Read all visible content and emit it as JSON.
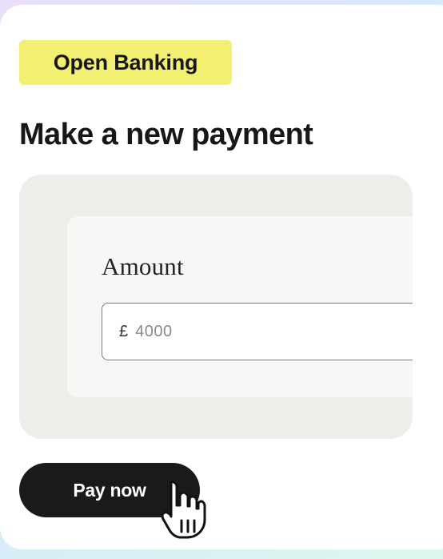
{
  "badge": {
    "label": "Open Banking"
  },
  "page": {
    "title": "Make a new payment"
  },
  "form": {
    "amount_label": "Amount",
    "currency_symbol": "£",
    "amount_value": "4000"
  },
  "actions": {
    "pay_label": "Pay now"
  },
  "pointer": {
    "icon": "hand-cursor-icon"
  },
  "colors": {
    "badge": "#f2ef72",
    "button": "#1a1a1a",
    "panel": "#efedea",
    "inner_panel": "#f8f7f5"
  }
}
